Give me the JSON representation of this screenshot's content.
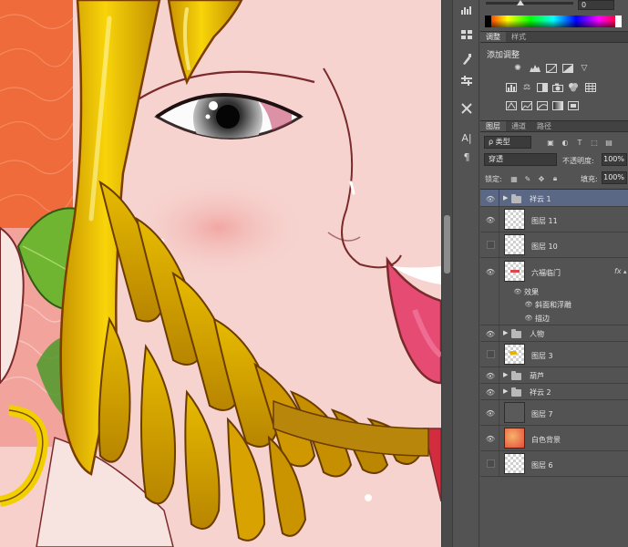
{
  "color_panel": {
    "value": "0",
    "colors": {
      "black": "#000000",
      "white": "#ffffff"
    }
  },
  "adjustments": {
    "tabs": [
      "调整",
      "样式"
    ],
    "active_tab": 0,
    "title": "添加调整",
    "icons_row1": [
      "brightness-icon",
      "levels-icon",
      "curves-icon",
      "exposure-icon",
      "vibrance-icon"
    ],
    "icons_row2": [
      "hue-icon",
      "color-balance-icon",
      "bw-icon",
      "photo-filter-icon",
      "channel-mixer-icon",
      "lookup-icon"
    ],
    "icons_row3": [
      "invert-icon",
      "posterize-icon",
      "threshold-icon",
      "gradient-map-icon",
      "selective-color-icon"
    ]
  },
  "layers_panel": {
    "tabs": [
      "图层",
      "通道",
      "路径"
    ],
    "active_tab": 0,
    "filter_label": "ρ 类型",
    "blend_mode": "穿透",
    "opacity_label": "不透明度:",
    "opacity_value": "100%",
    "lock_label": "锁定:",
    "fill_label": "填充:",
    "fill_value": "100%"
  },
  "layers": [
    {
      "name": "祥云 1",
      "kind": "group",
      "visible": true,
      "selected": true,
      "expanded": false
    },
    {
      "name": "图层 11",
      "kind": "layer",
      "visible": true,
      "thumb": "checker"
    },
    {
      "name": "图层 10",
      "kind": "layer",
      "visible": false,
      "thumb": "checker"
    },
    {
      "name": "六福临门",
      "kind": "layer",
      "visible": true,
      "thumb": "checker-red",
      "fx": "fx"
    },
    {
      "name": "效果",
      "kind": "effect-header"
    },
    {
      "name": "斜面和浮雕",
      "kind": "effect"
    },
    {
      "name": "描边",
      "kind": "effect"
    },
    {
      "name": "人物",
      "kind": "group",
      "visible": true
    },
    {
      "name": "图层 3",
      "kind": "layer",
      "visible": false,
      "thumb": "checker-yellow"
    },
    {
      "name": "葫芦",
      "kind": "group",
      "visible": true
    },
    {
      "name": "祥云 2",
      "kind": "group",
      "visible": true
    },
    {
      "name": "图层 7",
      "kind": "layer",
      "visible": true,
      "thumb": "dark"
    },
    {
      "name": "白色背景",
      "kind": "layer",
      "visible": true,
      "thumb": "red"
    },
    {
      "name": "图层 6",
      "kind": "layer",
      "visible": false,
      "thumb": "checker"
    }
  ],
  "tool_strip": {
    "tools": [
      "bar-chart-icon",
      "swatch-icon",
      "info-icon",
      "brush-preset-icon",
      "properties-icon",
      "character-icon",
      "paragraph-icon"
    ]
  },
  "canvas_colors": {
    "skin": "#f5cfcb",
    "skin_shadow": "#eeb7b2",
    "gold": "#e6b800",
    "gold_dark": "#b98a00",
    "outline": "#7b2a2c",
    "leaf": "#5aa02c",
    "bg_orange": "#ef6a3a",
    "mouth": "#e64b73"
  }
}
